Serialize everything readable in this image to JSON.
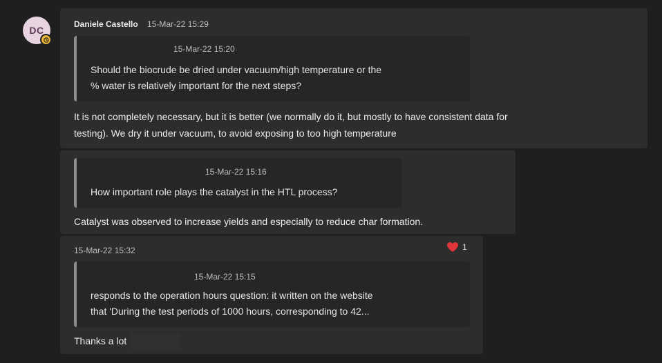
{
  "avatar": {
    "initials": "DC",
    "bg_color": "#e8d3e0",
    "status_color": "#e8b43a",
    "status_icon": "clock-icon"
  },
  "messages": [
    {
      "author": "Daniele Castello",
      "timestamp": "15-Mar-22 15:29",
      "quote": {
        "timestamp": "15-Mar-22 15:20",
        "lines": [
          "Should the biocrude be dried under vacuum/high temperature or the",
          "% water is relatively important for the next steps?"
        ]
      },
      "body_lines": [
        "It is not completely necessary, but it is better (we normally do it, but mostly to have consistent data for",
        "testing). We dry it under vacuum, to avoid exposing to too high temperature"
      ]
    },
    {
      "quote": {
        "timestamp": "15-Mar-22 15:16",
        "lines": [
          "How important role plays the catalyst in the HTL process?"
        ]
      },
      "body_lines": [
        "Catalyst was observed to increase yields and especially to reduce char formation."
      ]
    },
    {
      "timestamp": "15-Mar-22 15:32",
      "reaction": {
        "icon": "heart-icon",
        "count": "1",
        "color": "#e0353b"
      },
      "quote": {
        "timestamp": "15-Mar-22 15:15",
        "lines": [
          "responds to the operation hours question: it written on the website",
          "that 'During the test periods of 1000 hours, corresponding to 42..."
        ]
      },
      "body_lines": [
        "Thanks a lot"
      ]
    }
  ]
}
